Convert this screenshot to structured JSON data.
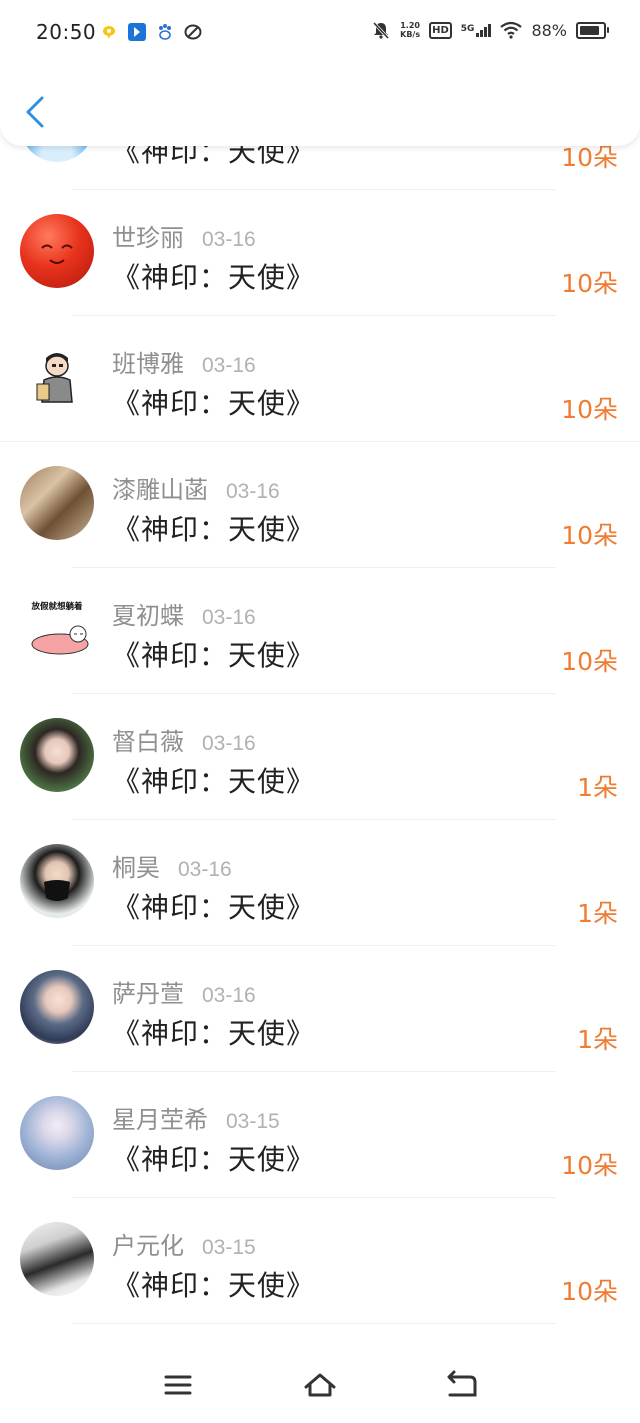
{
  "status_bar": {
    "time": "20:50",
    "net_speed_value": "1.20",
    "net_speed_unit": "KB/s",
    "hd_label": "HD",
    "network_label": "5G",
    "battery_percent": "88%",
    "battery_level": 0.88,
    "notification_icons": [
      "chat-bubble-icon",
      "arrow-app-icon",
      "paw-icon",
      "link-icon"
    ]
  },
  "header": {
    "back_icon": "chevron-left-icon",
    "accent_color": "#2f8fe0"
  },
  "gift_list": [
    {
      "name": "",
      "date": "",
      "title": "《神印：天使》",
      "amount": "10朵",
      "avatar": "blue-cartoon"
    },
    {
      "name": "世珍丽",
      "date": "03-16",
      "title": "《神印：天使》",
      "amount": "10朵",
      "avatar": "red-ball"
    },
    {
      "name": "班博雅",
      "date": "03-16",
      "title": "《神印：天使》",
      "amount": "10朵",
      "avatar": "cartoon-man"
    },
    {
      "name": "漆雕山菡",
      "date": "03-16",
      "title": "《神印：天使》",
      "amount": "10朵",
      "avatar": "couple-photo"
    },
    {
      "name": "夏初蝶",
      "date": "03-16",
      "title": "《神印：天使》",
      "amount": "10朵",
      "avatar": "meme-lying"
    },
    {
      "name": "督白薇",
      "date": "03-16",
      "title": "《神印：天使》",
      "amount": "1朵",
      "avatar": "girl-portrait"
    },
    {
      "name": "桐昊",
      "date": "03-16",
      "title": "《神印：天使》",
      "amount": "1朵",
      "avatar": "boy-mask"
    },
    {
      "name": "萨丹萱",
      "date": "03-16",
      "title": "《神印：天使》",
      "amount": "1朵",
      "avatar": "anime-girl"
    },
    {
      "name": "星月茔希",
      "date": "03-15",
      "title": "《神印：天使》",
      "amount": "10朵",
      "avatar": "white-hair-girl"
    },
    {
      "name": "户元化",
      "date": "03-15",
      "title": "《神印：天使》",
      "amount": "10朵",
      "avatar": "dark-boy"
    }
  ],
  "meme_avatar_caption": "放假就想躺着",
  "colors": {
    "amount": "#f07c32",
    "name": "#8f8f8f",
    "date": "#b1b1b1",
    "title": "#222222"
  },
  "nav_bar": {
    "buttons": [
      "menu-icon",
      "home-icon",
      "back-icon"
    ]
  }
}
